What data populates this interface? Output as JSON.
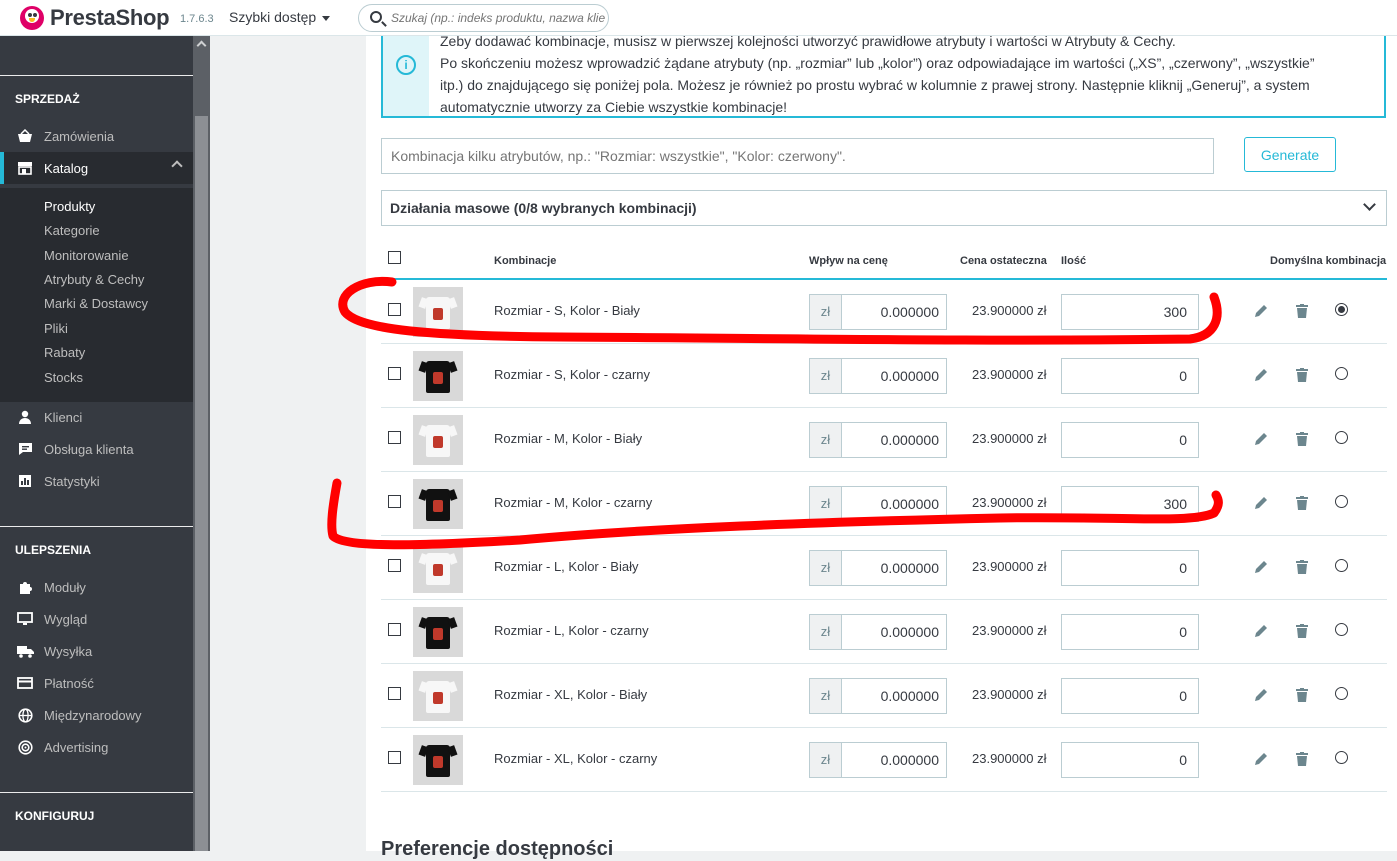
{
  "header": {
    "logo": "PrestaShop",
    "version": "1.7.6.3",
    "quick_access": "Szybki dostęp",
    "search_placeholder": "Szukaj (np.: indeks produktu, nazwa klie"
  },
  "sidebar": {
    "section_sell": "SPRZEDAŻ",
    "orders": "Zamówienia",
    "catalog": "Katalog",
    "catalog_sub": [
      "Produkty",
      "Kategorie",
      "Monitorowanie",
      "Atrybuty & Cechy",
      "Marki & Dostawcy",
      "Pliki",
      "Rabaty",
      "Stocks"
    ],
    "customers": "Klienci",
    "customer_service": "Obsługa klienta",
    "stats": "Statystyki",
    "section_improve": "ULEPSZENIA",
    "modules": "Moduły",
    "design": "Wygląd",
    "shipping": "Wysyłka",
    "payment": "Płatność",
    "international": "Międzynarodowy",
    "advertising": "Advertising",
    "section_configure": "KONFIGURUJ"
  },
  "alert": {
    "line1": "Żeby dodawać kombinacje, musisz w pierwszej kolejności utworzyć prawidłowe atrybuty i wartości w Atrybuty & Cechy.",
    "line2": "Po skończeniu możesz wprowadzić żądane atrybuty (np. „rozmiar” lub „kolor”) oraz odpowiadające im wartości („XS”, „czerwony”, „wszystkie”",
    "line3": "itp.) do znajdującego się poniżej pola. Możesz je również po prostu wybrać w kolumnie z prawej strony. Następnie kliknij „Generuj”, a system",
    "line4": "automatycznie utworzy za Ciebie wszystkie kombinacje!"
  },
  "combinations": {
    "input_placeholder": "Kombinacja kilku atrybutów, np.: \"Rozmiar: wszystkie\", \"Kolor: czerwony\".",
    "generate_label": "Generate",
    "bulk_title": "Działania masowe (0/8 wybranych kombinacji)",
    "headers": {
      "combination": "Kombinacje",
      "impact": "Wpływ na cenę",
      "final_price": "Cena ostateczna",
      "quantity": "Ilość",
      "default": "Domyślna kombinacja"
    },
    "currency": "zł",
    "rows": [
      {
        "name": "Rozmiar - S, Kolor - Biały",
        "impact": "0.000000",
        "final": "23.900000 zł",
        "qty": "300",
        "color": "white",
        "default": true
      },
      {
        "name": "Rozmiar - S, Kolor - czarny",
        "impact": "0.000000",
        "final": "23.900000 zł",
        "qty": "0",
        "color": "black",
        "default": false
      },
      {
        "name": "Rozmiar - M, Kolor - Biały",
        "impact": "0.000000",
        "final": "23.900000 zł",
        "qty": "0",
        "color": "white",
        "default": false
      },
      {
        "name": "Rozmiar - M, Kolor - czarny",
        "impact": "0.000000",
        "final": "23.900000 zł",
        "qty": "300",
        "color": "black",
        "default": false
      },
      {
        "name": "Rozmiar - L, Kolor - Biały",
        "impact": "0.000000",
        "final": "23.900000 zł",
        "qty": "0",
        "color": "white",
        "default": false
      },
      {
        "name": "Rozmiar - L, Kolor - czarny",
        "impact": "0.000000",
        "final": "23.900000 zł",
        "qty": "0",
        "color": "black",
        "default": false
      },
      {
        "name": "Rozmiar - XL, Kolor - Biały",
        "impact": "0.000000",
        "final": "23.900000 zł",
        "qty": "0",
        "color": "white",
        "default": false
      },
      {
        "name": "Rozmiar - XL, Kolor - czarny",
        "impact": "0.000000",
        "final": "23.900000 zł",
        "qty": "0",
        "color": "black",
        "default": false
      }
    ]
  },
  "prefs_title": "Preferencje dostępności",
  "colors": {
    "accent": "#25b9d7",
    "sidebar_bg": "#363a41",
    "annotation_red": "#ff0000"
  }
}
